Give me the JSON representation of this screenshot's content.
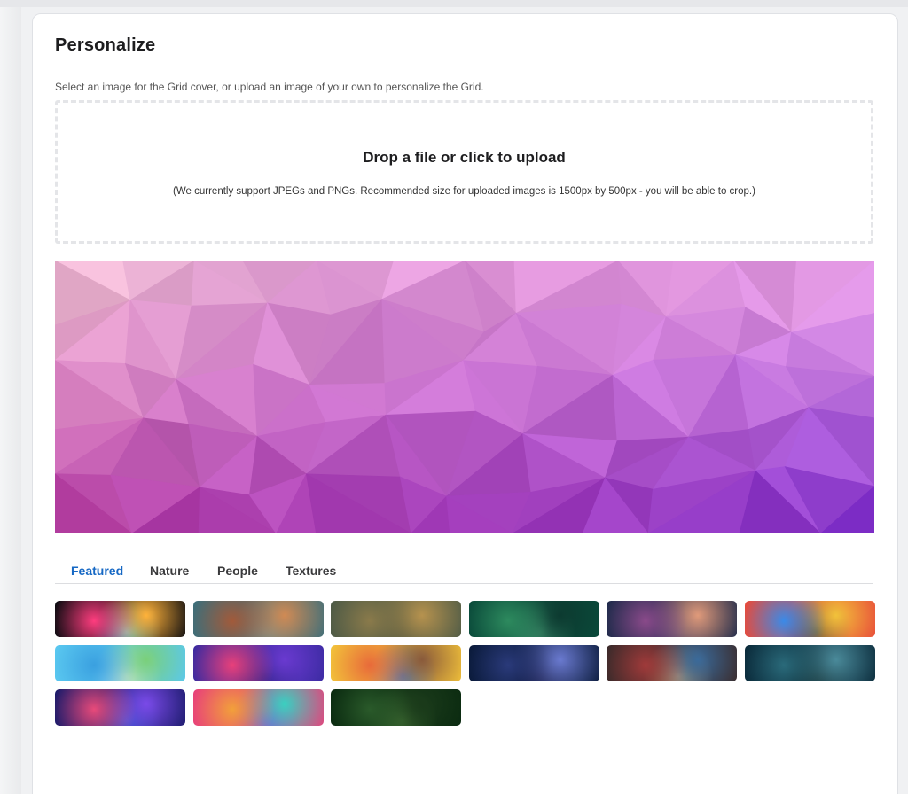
{
  "personalize": {
    "title": "Personalize",
    "description": "Select an image for the Grid cover, or upload an image of your own to personalize the Grid."
  },
  "upload": {
    "title": "Drop a file or click to upload",
    "note": "(We currently support JPEGs and PNGs. Recommended size for uploaded images is 1500px by 500px - you will be able to crop.)"
  },
  "cover": {
    "description_icon": "low-poly-gradient-cover",
    "colors": [
      "#f3c2d4",
      "#e67dd6",
      "#b54bd8",
      "#8e2ec6",
      "#6a26c9",
      "#d43aa8"
    ]
  },
  "tabs": [
    {
      "label": "Featured",
      "active": true
    },
    {
      "label": "Nature",
      "active": false
    },
    {
      "label": "People",
      "active": false
    },
    {
      "label": "Textures",
      "active": false
    }
  ],
  "thumbnails": [
    {
      "name": "paint-explosion",
      "colors": [
        "#0b0b10",
        "#ff3d7f",
        "#ffb23a",
        "#3ad0ff"
      ]
    },
    {
      "name": "coral-aerial",
      "colors": [
        "#3c6e7a",
        "#a25a3a",
        "#d08a54",
        "#5a8f9a"
      ]
    },
    {
      "name": "desert-aerial",
      "colors": [
        "#4d5a46",
        "#8a7a4a",
        "#b6924e",
        "#3a4a3c"
      ]
    },
    {
      "name": "fern-leaves",
      "colors": [
        "#0a4a3a",
        "#2d8a5e",
        "#0c3a30",
        "#4aa07a"
      ]
    },
    {
      "name": "cartoon-cat",
      "colors": [
        "#1e2a4a",
        "#8a4a8a",
        "#e09a7a",
        "#3a3a6a"
      ]
    },
    {
      "name": "graffiti-art",
      "colors": [
        "#e84a3a",
        "#3a8ae8",
        "#f2c23a",
        "#2a2a3a"
      ]
    },
    {
      "name": "cartoon-earth",
      "colors": [
        "#5ac8f0",
        "#3aa0e0",
        "#7ad07a",
        "#f2f2f2"
      ]
    },
    {
      "name": "neon-mountains",
      "colors": [
        "#3a2aa0",
        "#e8407a",
        "#6a3ad0",
        "#1a1a6a"
      ]
    },
    {
      "name": "cartoon-kids",
      "colors": [
        "#f2c23a",
        "#e86a3a",
        "#8a5a3a",
        "#3a8ae8"
      ]
    },
    {
      "name": "starry-sky",
      "colors": [
        "#0a1a3a",
        "#2a3a7a",
        "#6a7ad0",
        "#0a0a2a"
      ]
    },
    {
      "name": "book-shelf",
      "colors": [
        "#3a2a2a",
        "#a03a3a",
        "#3a6a9a",
        "#d0b07a"
      ]
    },
    {
      "name": "elephant-forest",
      "colors": [
        "#0a2a3a",
        "#2a6a7a",
        "#4a8a9a",
        "#0a1a1a"
      ]
    },
    {
      "name": "network-lights",
      "colors": [
        "#1a1a6a",
        "#e84a7a",
        "#7a4ae8",
        "#2a5ad0"
      ]
    },
    {
      "name": "colorful-pattern",
      "colors": [
        "#e8407a",
        "#f2a03a",
        "#3ad0c0",
        "#7a3ae8"
      ]
    },
    {
      "name": "forest-canopy",
      "colors": [
        "#0a2a10",
        "#2a5a2a",
        "#1a3a1a",
        "#4a7a3a"
      ]
    }
  ]
}
